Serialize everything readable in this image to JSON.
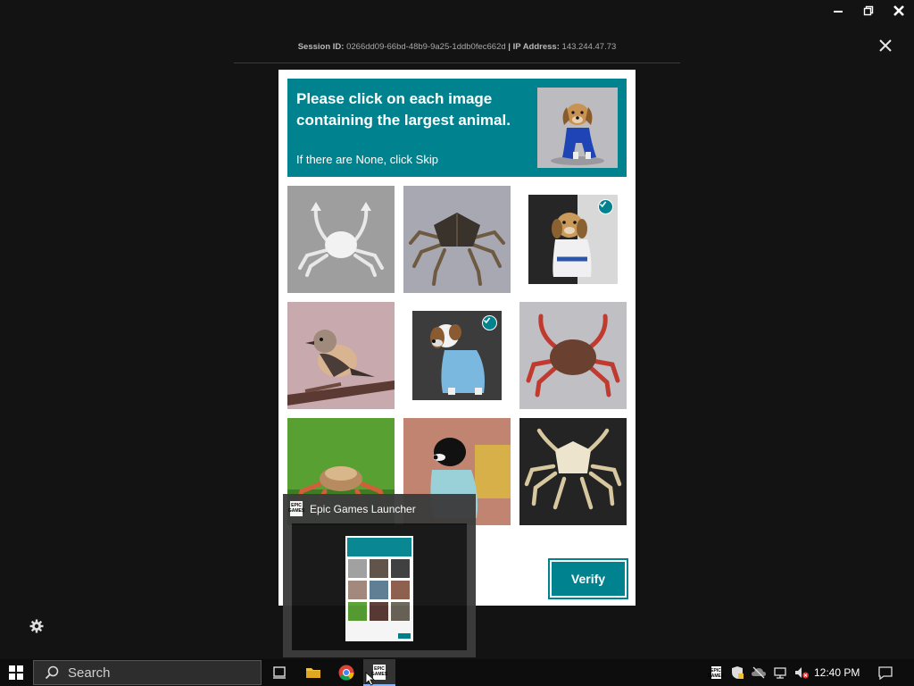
{
  "session": {
    "id_label": "Session ID:",
    "id_value": "0266dd09-66bd-48b9-9a25-1ddb0fec662d",
    "separator": "|",
    "ip_label": "IP Address:",
    "ip_value": "143.244.47.73"
  },
  "captcha": {
    "title_line1": "Please click on each image",
    "title_line2": "containing the largest animal.",
    "subtitle": "If there are None, click Skip",
    "verify_label": "Verify",
    "tiles": [
      {
        "subject": "crab",
        "selected": false
      },
      {
        "subject": "crab",
        "selected": false
      },
      {
        "subject": "dog",
        "selected": true
      },
      {
        "subject": "bird",
        "selected": false
      },
      {
        "subject": "dog",
        "selected": true
      },
      {
        "subject": "crab",
        "selected": false
      },
      {
        "subject": "crab",
        "selected": false
      },
      {
        "subject": "dog",
        "selected": false
      },
      {
        "subject": "crab",
        "selected": false
      }
    ]
  },
  "task_preview": {
    "app_name": "Epic Games Launcher",
    "logo_text": "EPIC GAMES"
  },
  "taskbar": {
    "search_label": "Search",
    "clock": "12:40 PM"
  },
  "colors": {
    "accent": "#00838f",
    "background": "#131313",
    "taskbar": "#0d0d0d"
  }
}
